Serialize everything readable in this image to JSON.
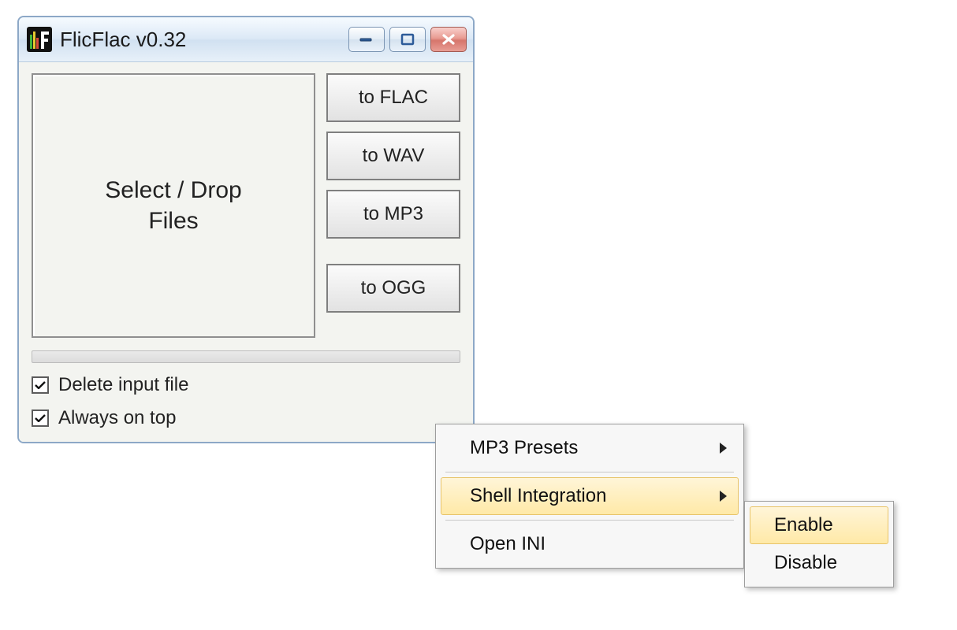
{
  "window": {
    "title": "FlicFlac v0.32"
  },
  "drop": {
    "label": "Select / Drop\nFiles"
  },
  "formats": {
    "flac": "to FLAC",
    "wav": "to WAV",
    "mp3": "to MP3",
    "ogg": "to OGG"
  },
  "options": {
    "delete_input": {
      "label": "Delete input file",
      "checked": true
    },
    "always_on_top": {
      "label": "Always on top",
      "checked": true
    }
  },
  "context_menu": {
    "mp3_presets": "MP3 Presets",
    "shell_integration": "Shell Integration",
    "open_ini": "Open INI"
  },
  "submenu": {
    "enable": "Enable",
    "disable": "Disable"
  }
}
